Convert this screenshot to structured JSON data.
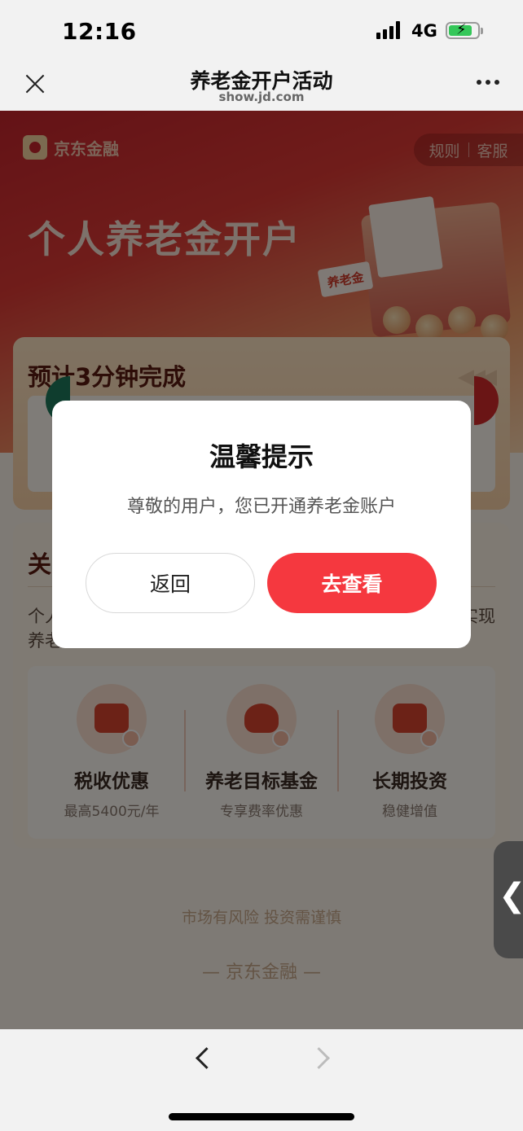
{
  "status_bar": {
    "time": "12:16",
    "network": "4G",
    "battery_charging": true,
    "battery_color": "#34c759"
  },
  "nav": {
    "title": "养老金开户活动",
    "subtitle": "show.jd.com",
    "close_icon": "close-icon",
    "more_icon": "more-icon"
  },
  "page": {
    "brand": "京东金融",
    "rules_label": "规则",
    "service_label": "客服",
    "hero_title": "个人养老金开户",
    "hero_tag": "养老金",
    "steps_title": "预计3分钟完成",
    "about_title": "关",
    "about_text_line1": "个人",
    "about_text_right": "实现",
    "about_text_line2": "养老",
    "benefits": [
      {
        "name": "税收优惠",
        "sub": "最高5400元/年",
        "icon": "ticket-icon"
      },
      {
        "name": "养老目标基金",
        "sub": "专享费率优惠",
        "icon": "money-bag-icon"
      },
      {
        "name": "长期投资",
        "sub": "稳健增值",
        "icon": "wallet-icon"
      }
    ],
    "risk_notice": "市场有风险 投资需谨慎",
    "footer_brand": "— 京东金融 —",
    "accent_color": "#f5383f"
  },
  "dialog": {
    "title": "温馨提示",
    "message": "尊敬的用户，您已开通养老金账户",
    "back_label": "返回",
    "view_label": "去查看"
  },
  "toolbar": {
    "back_icon": "chevron-left-icon",
    "forward_icon": "chevron-right-icon"
  }
}
